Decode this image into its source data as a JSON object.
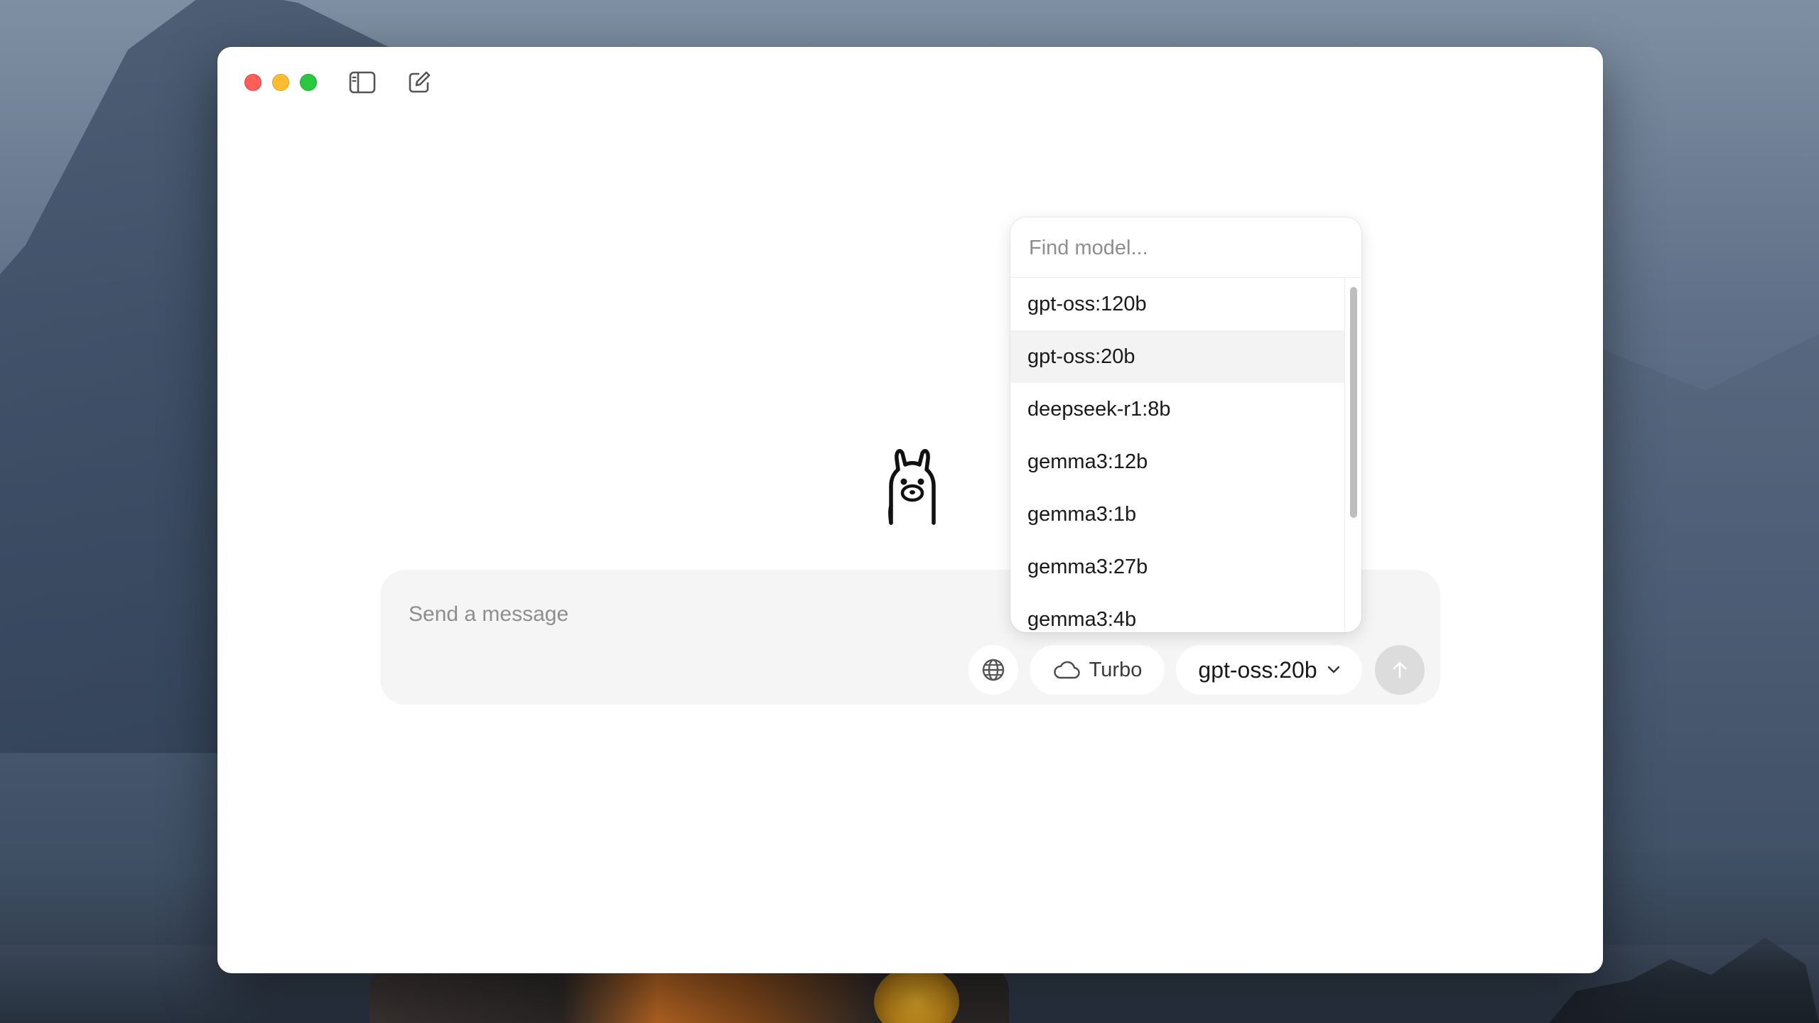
{
  "window": {
    "traffic_lights": {
      "close_color": "#ff5f57",
      "minimize_color": "#febc2e",
      "maximize_color": "#28c840"
    },
    "toolbar": {
      "sidebar_icon": "sidebar-toggle-icon",
      "compose_icon": "new-chat-icon"
    }
  },
  "main": {
    "logo_icon": "llama-logo-icon"
  },
  "composer": {
    "placeholder": "Send a message",
    "value": "",
    "web_search_icon": "globe-icon",
    "turbo": {
      "label": "Turbo",
      "icon": "cloud-icon"
    },
    "model_selector": {
      "selected": "gpt-oss:20b",
      "icon": "chevron-down-icon"
    },
    "send_icon": "arrow-up-icon"
  },
  "model_dropdown": {
    "search_placeholder": "Find model...",
    "items": [
      {
        "label": "gpt-oss:120b",
        "selected": false
      },
      {
        "label": "gpt-oss:20b",
        "selected": true
      },
      {
        "label": "deepseek-r1:8b",
        "selected": false
      },
      {
        "label": "gemma3:12b",
        "selected": false
      },
      {
        "label": "gemma3:1b",
        "selected": false
      },
      {
        "label": "gemma3:27b",
        "selected": false
      },
      {
        "label": "gemma3:4b",
        "selected": false
      }
    ],
    "highlight_color": "#f3f3f3"
  }
}
